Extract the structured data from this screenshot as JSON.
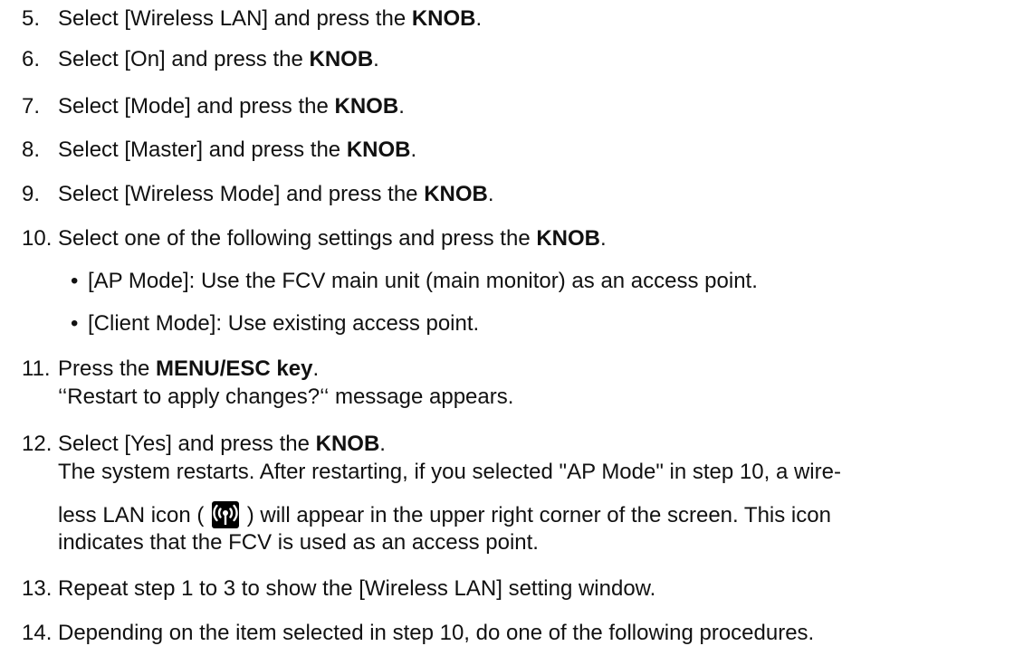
{
  "steps": [
    {
      "num": "5.",
      "parts": [
        "Select [Wireless LAN] and press the ",
        "KNOB",
        "."
      ]
    },
    {
      "num": "6.",
      "parts": [
        "Select [On] and press the ",
        "KNOB",
        "."
      ]
    },
    {
      "num": "7.",
      "parts": [
        "Select [Mode] and press the ",
        "KNOB",
        "."
      ]
    },
    {
      "num": "8.",
      "parts": [
        "Select [Master] and press the ",
        "KNOB",
        "."
      ]
    },
    {
      "num": "9.",
      "parts": [
        "Select [Wireless Mode] and press the ",
        "KNOB",
        "."
      ]
    },
    {
      "num": "10.",
      "parts": [
        "Select one of the following settings and press the ",
        "KNOB",
        "."
      ],
      "bullets": [
        "[AP Mode]: Use the FCV main unit (main monitor) as an access point.",
        "[Client Mode]: Use existing access point."
      ]
    },
    {
      "num": "11.",
      "parts": [
        "Press the ",
        "MENU/ESC key",
        "."
      ],
      "extra": "‘‘Restart to apply changes?‘‘ message appears."
    },
    {
      "num": "12.",
      "parts": [
        "Select [Yes] and press the ",
        "KNOB",
        "."
      ],
      "extra1": "The system restarts. After restarting, if you selected \"AP Mode\" in step 10, a wire-",
      "extra2_pre": "less LAN icon ( ",
      "extra2_post": " ) will appear in the upper right corner of the screen. This icon",
      "extra3": "indicates that the FCV is used as an access point."
    },
    {
      "num": "13.",
      "text": "Repeat step 1 to 3 to show the [Wireless LAN] setting window."
    },
    {
      "num": "14.",
      "text": "Depending on the item selected in step 10, do one of the following procedures."
    }
  ],
  "bullet_char": "•",
  "icon": "wireless-lan-icon"
}
